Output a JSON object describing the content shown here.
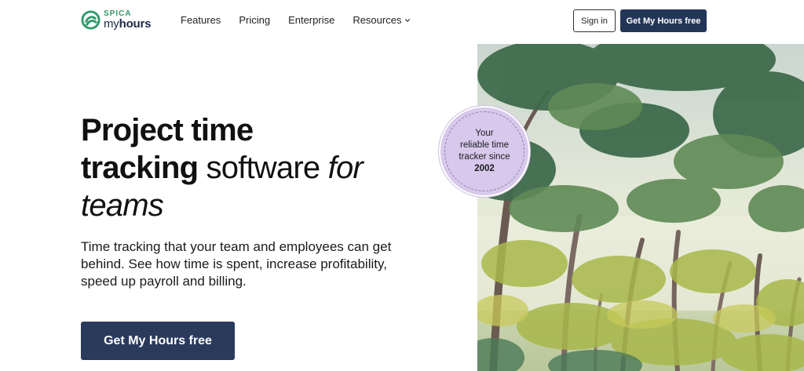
{
  "brand": {
    "small": "SPICA",
    "name_prefix": "my",
    "name_suffix": "hours",
    "color_green": "#2f9a6b",
    "color_navy": "#1b2a4a"
  },
  "nav": {
    "items": [
      "Features",
      "Pricing",
      "Enterprise",
      "Resources"
    ],
    "dropdown_icon": "chevron-down-icon"
  },
  "header": {
    "signin_label": "Sign in",
    "cta_label": "Get My Hours free",
    "cta_color": "#243657"
  },
  "hero": {
    "title_part1": "Project time",
    "title_part2": "tracking",
    "title_part3": " software ",
    "title_part4": "for",
    "title_part5": "teams",
    "subtitle": "Time tracking that your team and employees can get behind. See how time is spent, increase profitability, speed up payroll and billing.",
    "cta_label": "Get My Hours free"
  },
  "badge": {
    "line1": "Your",
    "line2": "reliable time",
    "line3": "tracker since",
    "year": "2002",
    "color": "#d7c8ec"
  }
}
